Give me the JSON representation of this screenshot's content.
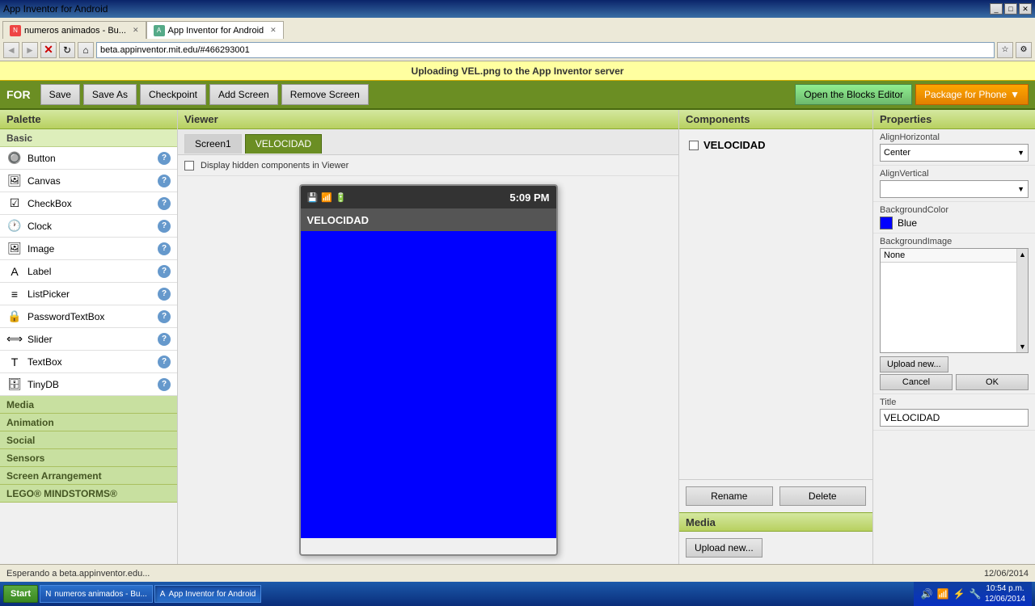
{
  "browser": {
    "title": "App Inventor for Android",
    "tabs": [
      {
        "label": "numeros animados - Bu...",
        "active": false,
        "favicon": "N"
      },
      {
        "label": "App Inventor for Android",
        "active": true,
        "favicon": "A"
      }
    ],
    "address": "beta.appinventor.mit.edu/#466293001",
    "nav": {
      "back": "◄",
      "forward": "►",
      "refresh": "↻",
      "stop": "✕",
      "home": "⌂"
    }
  },
  "notification": {
    "text": "Uploading VEL.png to the App Inventor server"
  },
  "toolbar": {
    "logo": "FOR",
    "save_label": "Save",
    "save_as_label": "Save As",
    "checkpoint_label": "Checkpoint",
    "add_screen_label": "Add Screen",
    "remove_screen_label": "Remove Screen",
    "blocks_editor_label": "Open the Blocks Editor",
    "package_label": "Package for Phone",
    "package_arrow": "▼"
  },
  "palette": {
    "title": "Palette",
    "basic_label": "Basic",
    "items": [
      {
        "label": "Button",
        "icon": "🔘"
      },
      {
        "label": "Canvas",
        "icon": "🖼"
      },
      {
        "label": "CheckBox",
        "icon": "☑"
      },
      {
        "label": "Clock",
        "icon": "🕐"
      },
      {
        "label": "Image",
        "icon": "🖼"
      },
      {
        "label": "Label",
        "icon": "A"
      },
      {
        "label": "ListPicker",
        "icon": "≡"
      },
      {
        "label": "PasswordTextBox",
        "icon": "🔒"
      },
      {
        "label": "Slider",
        "icon": "⟺"
      },
      {
        "label": "TextBox",
        "icon": "T"
      },
      {
        "label": "TinyDB",
        "icon": "🗄"
      }
    ],
    "media_label": "Media",
    "animation_label": "Animation",
    "social_label": "Social",
    "sensors_label": "Sensors",
    "screen_arrangement_label": "Screen Arrangement",
    "lego_label": "LEGO® MINDSTORMS®"
  },
  "viewer": {
    "title": "Viewer",
    "tabs": [
      {
        "label": "Screen1",
        "active": false
      },
      {
        "label": "VELOCIDAD",
        "active": true
      }
    ],
    "hidden_components_label": "Display hidden components in Viewer",
    "phone": {
      "time": "5:09 PM",
      "title": "VELOCIDAD",
      "bg_color": "blue"
    }
  },
  "components": {
    "title": "Components",
    "items": [
      {
        "label": "VELOCIDAD",
        "checked": false
      }
    ],
    "rename_label": "Rename",
    "delete_label": "Delete",
    "media_label": "Media",
    "upload_new_label": "Upload new..."
  },
  "properties": {
    "title": "Properties",
    "align_horizontal_label": "AlignHorizontal",
    "align_horizontal_value": "Center",
    "align_vertical_label": "AlignVertical",
    "align_vertical_value": "",
    "background_color_label": "BackgroundColor",
    "background_color_name": "Blue",
    "background_image_label": "BackgroundImage",
    "background_image_value": "None",
    "upload_new_label": "Upload new...",
    "cancel_label": "Cancel",
    "ok_label": "OK",
    "title_label": "Title",
    "title_value": "VELOCIDAD"
  },
  "status_bar": {
    "text": "Esperando a beta.appinventor.edu...",
    "datetime": "12/06/2014",
    "time": "10:54 p.m."
  },
  "taskbar": {
    "start_label": "Start",
    "items": [
      {
        "label": "numeros animados - Bu...",
        "active": false
      },
      {
        "label": "App Inventor for Android",
        "active": true
      }
    ],
    "systray_time": "10:54 p.m.",
    "systray_date": "12/06/2014"
  }
}
